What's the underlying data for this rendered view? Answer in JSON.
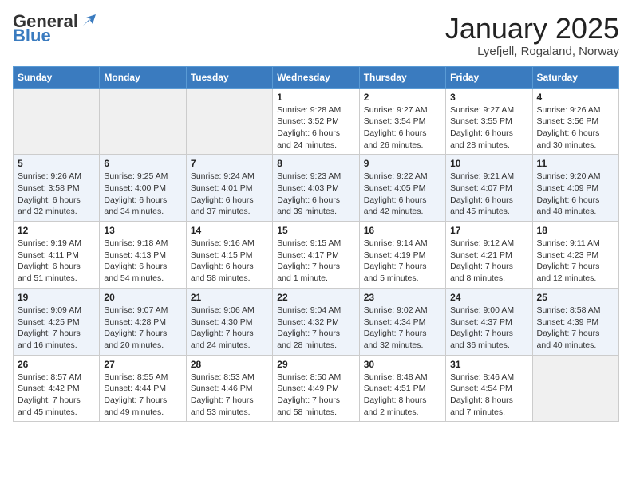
{
  "header": {
    "logo_general": "General",
    "logo_blue": "Blue",
    "month_title": "January 2025",
    "location": "Lyefjell, Rogaland, Norway"
  },
  "days_of_week": [
    "Sunday",
    "Monday",
    "Tuesday",
    "Wednesday",
    "Thursday",
    "Friday",
    "Saturday"
  ],
  "weeks": [
    [
      {
        "day": "",
        "info": ""
      },
      {
        "day": "",
        "info": ""
      },
      {
        "day": "",
        "info": ""
      },
      {
        "day": "1",
        "info": "Sunrise: 9:28 AM\nSunset: 3:52 PM\nDaylight: 6 hours and 24 minutes."
      },
      {
        "day": "2",
        "info": "Sunrise: 9:27 AM\nSunset: 3:54 PM\nDaylight: 6 hours and 26 minutes."
      },
      {
        "day": "3",
        "info": "Sunrise: 9:27 AM\nSunset: 3:55 PM\nDaylight: 6 hours and 28 minutes."
      },
      {
        "day": "4",
        "info": "Sunrise: 9:26 AM\nSunset: 3:56 PM\nDaylight: 6 hours and 30 minutes."
      }
    ],
    [
      {
        "day": "5",
        "info": "Sunrise: 9:26 AM\nSunset: 3:58 PM\nDaylight: 6 hours and 32 minutes."
      },
      {
        "day": "6",
        "info": "Sunrise: 9:25 AM\nSunset: 4:00 PM\nDaylight: 6 hours and 34 minutes."
      },
      {
        "day": "7",
        "info": "Sunrise: 9:24 AM\nSunset: 4:01 PM\nDaylight: 6 hours and 37 minutes."
      },
      {
        "day": "8",
        "info": "Sunrise: 9:23 AM\nSunset: 4:03 PM\nDaylight: 6 hours and 39 minutes."
      },
      {
        "day": "9",
        "info": "Sunrise: 9:22 AM\nSunset: 4:05 PM\nDaylight: 6 hours and 42 minutes."
      },
      {
        "day": "10",
        "info": "Sunrise: 9:21 AM\nSunset: 4:07 PM\nDaylight: 6 hours and 45 minutes."
      },
      {
        "day": "11",
        "info": "Sunrise: 9:20 AM\nSunset: 4:09 PM\nDaylight: 6 hours and 48 minutes."
      }
    ],
    [
      {
        "day": "12",
        "info": "Sunrise: 9:19 AM\nSunset: 4:11 PM\nDaylight: 6 hours and 51 minutes."
      },
      {
        "day": "13",
        "info": "Sunrise: 9:18 AM\nSunset: 4:13 PM\nDaylight: 6 hours and 54 minutes."
      },
      {
        "day": "14",
        "info": "Sunrise: 9:16 AM\nSunset: 4:15 PM\nDaylight: 6 hours and 58 minutes."
      },
      {
        "day": "15",
        "info": "Sunrise: 9:15 AM\nSunset: 4:17 PM\nDaylight: 7 hours and 1 minute."
      },
      {
        "day": "16",
        "info": "Sunrise: 9:14 AM\nSunset: 4:19 PM\nDaylight: 7 hours and 5 minutes."
      },
      {
        "day": "17",
        "info": "Sunrise: 9:12 AM\nSunset: 4:21 PM\nDaylight: 7 hours and 8 minutes."
      },
      {
        "day": "18",
        "info": "Sunrise: 9:11 AM\nSunset: 4:23 PM\nDaylight: 7 hours and 12 minutes."
      }
    ],
    [
      {
        "day": "19",
        "info": "Sunrise: 9:09 AM\nSunset: 4:25 PM\nDaylight: 7 hours and 16 minutes."
      },
      {
        "day": "20",
        "info": "Sunrise: 9:07 AM\nSunset: 4:28 PM\nDaylight: 7 hours and 20 minutes."
      },
      {
        "day": "21",
        "info": "Sunrise: 9:06 AM\nSunset: 4:30 PM\nDaylight: 7 hours and 24 minutes."
      },
      {
        "day": "22",
        "info": "Sunrise: 9:04 AM\nSunset: 4:32 PM\nDaylight: 7 hours and 28 minutes."
      },
      {
        "day": "23",
        "info": "Sunrise: 9:02 AM\nSunset: 4:34 PM\nDaylight: 7 hours and 32 minutes."
      },
      {
        "day": "24",
        "info": "Sunrise: 9:00 AM\nSunset: 4:37 PM\nDaylight: 7 hours and 36 minutes."
      },
      {
        "day": "25",
        "info": "Sunrise: 8:58 AM\nSunset: 4:39 PM\nDaylight: 7 hours and 40 minutes."
      }
    ],
    [
      {
        "day": "26",
        "info": "Sunrise: 8:57 AM\nSunset: 4:42 PM\nDaylight: 7 hours and 45 minutes."
      },
      {
        "day": "27",
        "info": "Sunrise: 8:55 AM\nSunset: 4:44 PM\nDaylight: 7 hours and 49 minutes."
      },
      {
        "day": "28",
        "info": "Sunrise: 8:53 AM\nSunset: 4:46 PM\nDaylight: 7 hours and 53 minutes."
      },
      {
        "day": "29",
        "info": "Sunrise: 8:50 AM\nSunset: 4:49 PM\nDaylight: 7 hours and 58 minutes."
      },
      {
        "day": "30",
        "info": "Sunrise: 8:48 AM\nSunset: 4:51 PM\nDaylight: 8 hours and 2 minutes."
      },
      {
        "day": "31",
        "info": "Sunrise: 8:46 AM\nSunset: 4:54 PM\nDaylight: 8 hours and 7 minutes."
      },
      {
        "day": "",
        "info": ""
      }
    ]
  ]
}
